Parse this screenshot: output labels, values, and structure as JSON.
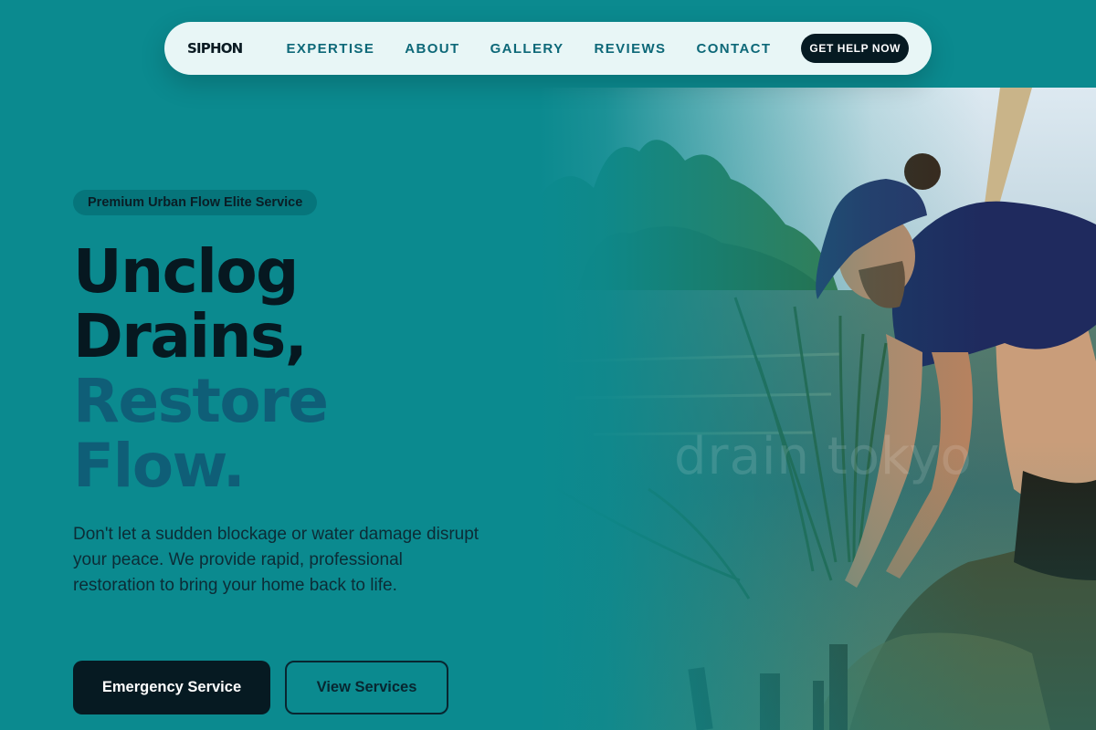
{
  "nav": {
    "brand": "SIPHON",
    "links": [
      {
        "label": "EXPERTISE"
      },
      {
        "label": "ABOUT"
      },
      {
        "label": "GALLERY"
      },
      {
        "label": "REVIEWS"
      },
      {
        "label": "CONTACT"
      }
    ],
    "cta_label": "GET HELP NOW"
  },
  "hero": {
    "badge": "Premium Urban Flow Elite Service",
    "headline_line1": "Unclog",
    "headline_line2": "Drains,",
    "headline_line3": "Restore",
    "headline_line4": "Flow.",
    "subtext": "Don't let a sudden blockage or water damage disrupt your peace. We provide rapid, professional restoration to bring your home back to life.",
    "primary_button": "Emergency Service",
    "secondary_button": "View Services",
    "image_watermark": "drain tokyo"
  },
  "colors": {
    "background": "#0b8a8f",
    "nav_background": "#e8f6f6",
    "dark": "#061a22",
    "accent_text": "#0f5e77",
    "nav_link": "#0d6878"
  }
}
